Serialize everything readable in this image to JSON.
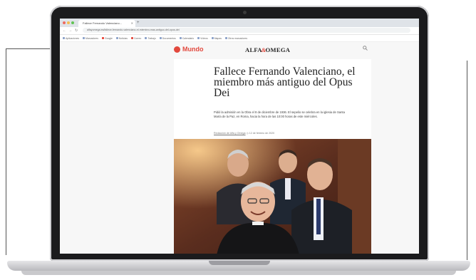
{
  "browser": {
    "tab_title": "Fallece Fernando Valenciano...",
    "new_tab": "+",
    "url": "alfayomega.es/fallece-fernando-valenciano-el-miembro-mas-antiguo-del-opus-dei",
    "bookmarks": [
      "Aplicaciones",
      "Marcadores",
      "Google",
      "Noticias",
      "Correo",
      "Trabajo",
      "Documentos",
      "Calendario",
      "Vídeos",
      "Mapas",
      "Otros marcadores"
    ]
  },
  "site": {
    "section": "Mundo",
    "logo_left": "ALFA",
    "logo_amp": "&",
    "logo_right": "OMEGA"
  },
  "article": {
    "headline": "Fallece Fernando Valenciano, el miembro más antiguo del Opus Dei",
    "lead": "Pidió la admisión en la Obra el 8 de diciembre de 1936. El sepelio se celebra en la iglesia de Santa María de la Paz, en Roma, hacia la hora de las 10:00 horas de este miércoles.",
    "byline": "Redacción de Alfa y Omega",
    "date": "12 de febrero de 2020"
  },
  "colors": {
    "accent": "#e2483d",
    "lid": "#1b1b1d",
    "photo_bg": "#5a2d1e"
  },
  "icons": [
    "search-icon",
    "close-icon",
    "back-icon",
    "forward-icon",
    "reload-icon"
  ]
}
